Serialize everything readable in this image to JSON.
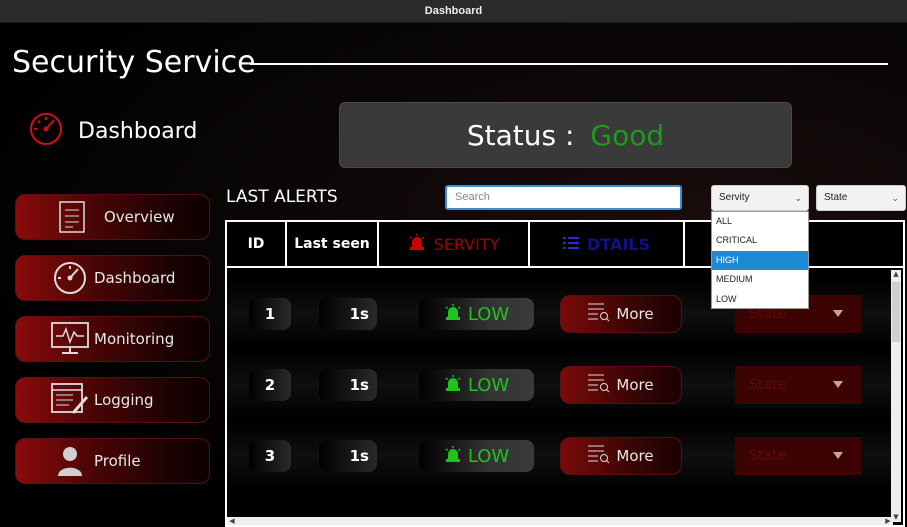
{
  "window": {
    "title": "Dashboard"
  },
  "app": {
    "title": "Security Service",
    "section_heading": "Dashboard"
  },
  "sidebar": {
    "items": [
      {
        "label": "Overview",
        "icon": "document-list-icon"
      },
      {
        "label": "Dashboard",
        "icon": "speedometer-icon"
      },
      {
        "label": "Monitoring",
        "icon": "monitor-pulse-icon"
      },
      {
        "label": "Logging",
        "icon": "log-edit-icon"
      },
      {
        "label": "Profile",
        "icon": "user-icon"
      }
    ]
  },
  "status": {
    "label": "Status :",
    "value": "Good",
    "value_color": "#1d9a1d"
  },
  "alerts": {
    "heading": "LAST ALERTS",
    "search_placeholder": "Search",
    "severity_filter": {
      "selected": "Servity",
      "options": [
        "ALL",
        "CRITICAL",
        "HIGH",
        "MEDIUM",
        "LOW"
      ],
      "highlighted": "HIGH"
    },
    "state_filter": {
      "selected": "State"
    },
    "columns": [
      "ID",
      "Last seen",
      "SERVITY",
      "DTAILS",
      ""
    ],
    "rows": [
      {
        "id": "1",
        "last_seen": "1s",
        "severity": "LOW",
        "details": "More",
        "state": "State"
      },
      {
        "id": "2",
        "last_seen": "1s",
        "severity": "LOW",
        "details": "More",
        "state": "State"
      },
      {
        "id": "3",
        "last_seen": "1s",
        "severity": "LOW",
        "details": "More",
        "state": "State"
      }
    ]
  },
  "colors": {
    "accent": "#8a0b0b",
    "good": "#1d9a1d",
    "low": "#1fc21f",
    "severity_header": "#a00000",
    "details_header": "#10108a",
    "dropdown_highlight": "#1e8ad6"
  }
}
